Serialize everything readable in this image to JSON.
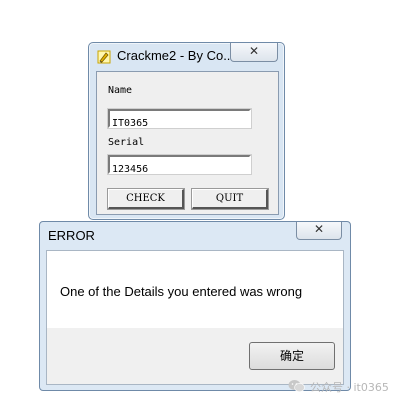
{
  "crackme": {
    "title": "Crackme2 - By Co...",
    "close_glyph": "✕",
    "name_label": "Name",
    "name_value": "IT0365",
    "serial_label": "Serial",
    "serial_value": "123456",
    "check_label": "CHECK",
    "quit_label": "QUIT"
  },
  "error_dialog": {
    "title": "ERROR",
    "close_glyph": "✕",
    "message": "One of the Details you entered was wrong",
    "ok_label": "确定"
  },
  "watermark": {
    "text": "公众号 · it0365"
  },
  "icons": {
    "app_icon": "pencil-app-icon",
    "watermark_icon": "wechat-icon"
  }
}
